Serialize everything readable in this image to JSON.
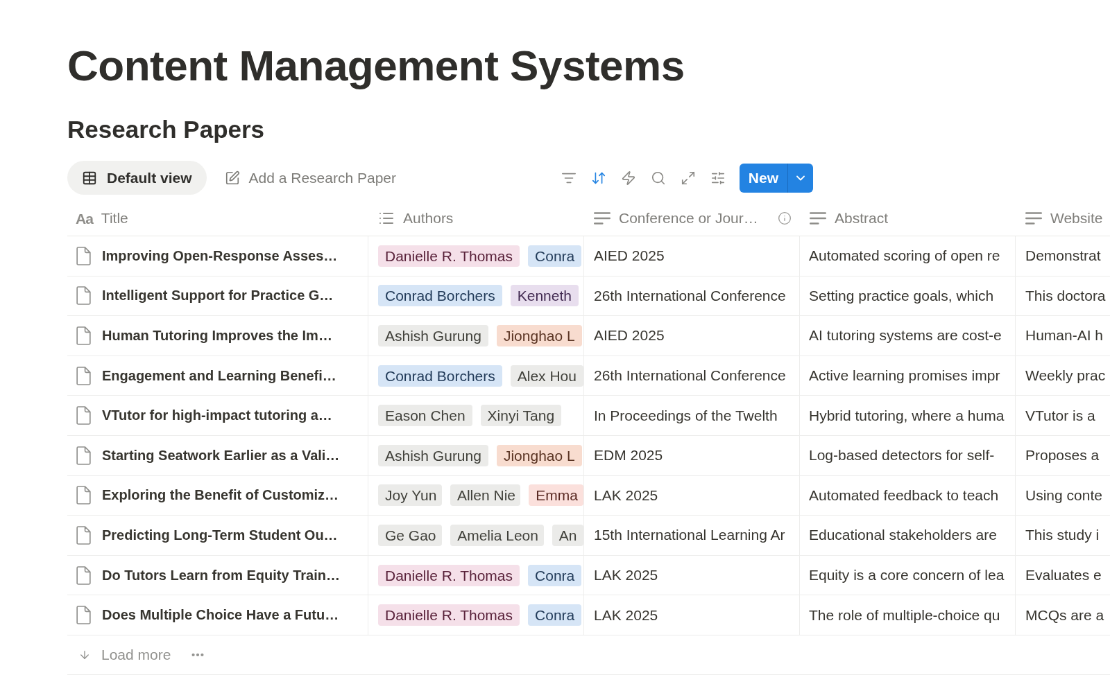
{
  "page": {
    "title": "Content Management Systems"
  },
  "database": {
    "title": "Research Papers",
    "views": [
      {
        "label": "Default view",
        "kind": "table",
        "selected": true
      }
    ],
    "add_page": {
      "label": "Add a Research Paper"
    },
    "tools": [
      {
        "kind": "filter",
        "active": false
      },
      {
        "kind": "sort",
        "active": true
      },
      {
        "kind": "automations",
        "active": false
      },
      {
        "kind": "search",
        "active": false
      },
      {
        "kind": "expand",
        "active": false
      },
      {
        "kind": "settings",
        "active": false
      }
    ],
    "new_button": {
      "label": "New"
    },
    "columns": [
      {
        "label": "Title",
        "kind": "title",
        "glyph": "Aa"
      },
      {
        "label": "Authors",
        "kind": "multi_select"
      },
      {
        "label": "Conference or Jour…",
        "kind": "text",
        "info": true
      },
      {
        "label": "Abstract",
        "kind": "text"
      },
      {
        "label": "Website",
        "kind": "text"
      }
    ],
    "rows": [
      {
        "title": "Improving Open-Response Asses…",
        "authors": [
          {
            "name": "Danielle R. Thomas",
            "color": "#f5e0e9"
          },
          {
            "name": "Conra",
            "color": "#d6e5f6"
          }
        ],
        "conference": "AIED 2025",
        "abstract": "Automated scoring of open re",
        "website": "Demonstrat"
      },
      {
        "title": "Intelligent Support for Practice G…",
        "authors": [
          {
            "name": "Conrad Borchers",
            "color": "#d6e5f6"
          },
          {
            "name": "Kenneth",
            "color": "#e8deee"
          }
        ],
        "conference": "26th International Conference",
        "abstract": "Setting practice goals, which",
        "website": "This doctora"
      },
      {
        "title": "Human Tutoring Improves the Im…",
        "authors": [
          {
            "name": "Ashish Gurung",
            "color": "#ebebe9"
          },
          {
            "name": "Jionghao L",
            "color": "#f8dccf"
          }
        ],
        "conference": "AIED 2025",
        "abstract": "AI tutoring systems are cost-e",
        "website": "Human-AI h"
      },
      {
        "title": "Engagement and Learning Benefi…",
        "authors": [
          {
            "name": "Conrad Borchers",
            "color": "#d6e5f6"
          },
          {
            "name": "Alex Hou",
            "color": "#ebebe9"
          }
        ],
        "conference": "26th International Conference",
        "abstract": "Active learning promises impr",
        "website": "Weekly prac"
      },
      {
        "title": "VTutor for high-impact tutoring a…",
        "authors": [
          {
            "name": "Eason Chen",
            "color": "#ebebe9"
          },
          {
            "name": "Xinyi Tang",
            "color": "#ebebe9"
          }
        ],
        "conference": "In Proceedings of the Twelth",
        "abstract": "Hybrid tutoring, where a huma",
        "website": "VTutor is a"
      },
      {
        "title": "Starting Seatwork Earlier as a Vali…",
        "authors": [
          {
            "name": "Ashish Gurung",
            "color": "#ebebe9"
          },
          {
            "name": "Jionghao L",
            "color": "#f8dccf"
          }
        ],
        "conference": "EDM 2025",
        "abstract": "Log-based detectors for self-",
        "website": "Proposes a"
      },
      {
        "title": "Exploring the Benefit of Customiz…",
        "authors": [
          {
            "name": "Joy Yun",
            "color": "#ebebe9"
          },
          {
            "name": "Allen Nie",
            "color": "#ebebe9"
          },
          {
            "name": "Emma",
            "color": "#fbe0dc"
          }
        ],
        "conference": "LAK 2025",
        "abstract": "Automated feedback to teach",
        "website": "Using conte"
      },
      {
        "title": "Predicting Long-Term Student Ou…",
        "authors": [
          {
            "name": "Ge Gao",
            "color": "#ebebe9"
          },
          {
            "name": "Amelia Leon",
            "color": "#ebebe9"
          },
          {
            "name": "An",
            "color": "#ebebe9"
          }
        ],
        "conference": "15th International Learning Ar",
        "abstract": "Educational stakeholders are",
        "website": "This study i"
      },
      {
        "title": "Do Tutors Learn from Equity Train…",
        "authors": [
          {
            "name": "Danielle R. Thomas",
            "color": "#f5e0e9"
          },
          {
            "name": "Conra",
            "color": "#d6e5f6"
          }
        ],
        "conference": "LAK 2025",
        "abstract": "Equity is a core concern of lea",
        "website": "Evaluates e"
      },
      {
        "title": "Does Multiple Choice Have a Futu…",
        "authors": [
          {
            "name": "Danielle R. Thomas",
            "color": "#f5e0e9"
          },
          {
            "name": "Conra",
            "color": "#d6e5f6"
          }
        ],
        "conference": "LAK 2025",
        "abstract": "The role of multiple-choice qu",
        "website": "MCQs are a"
      }
    ],
    "load_more": {
      "label": "Load more"
    }
  }
}
